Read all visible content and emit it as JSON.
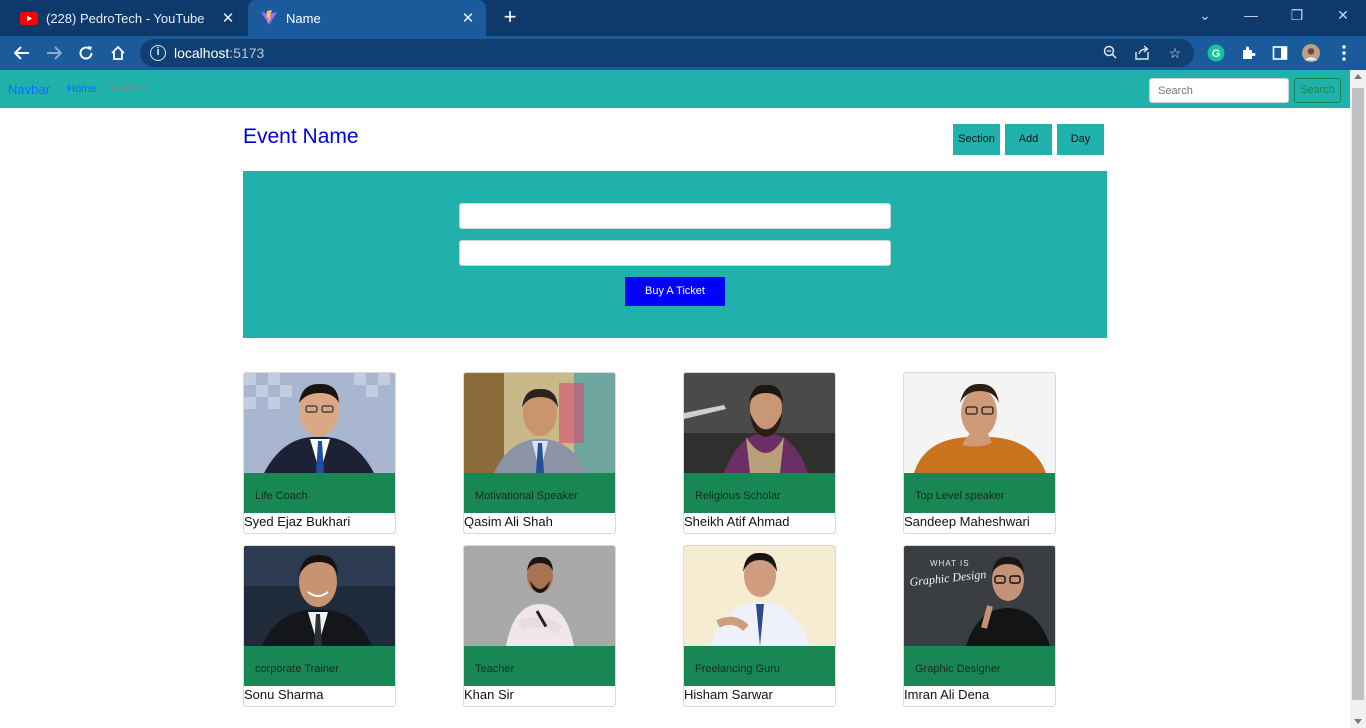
{
  "browser": {
    "tabs": [
      {
        "title": "(228) PedroTech - YouTube",
        "active": false
      },
      {
        "title": "Name",
        "active": true
      }
    ],
    "url_host": "localhost",
    "url_port": ":5173"
  },
  "navbar": {
    "brand": "Navbar",
    "home": "Home",
    "disabled": "Disabled",
    "search_placeholder": "Search",
    "search_button": "Search"
  },
  "event": {
    "title": "Event Name",
    "buttons": [
      "Section",
      "Add",
      "Day"
    ],
    "buy_button": "Buy A Ticket"
  },
  "speakers": [
    {
      "role": "Life Coach",
      "name": "Syed Ejaz Bukhari"
    },
    {
      "role": "Motivational Speaker",
      "name": "Qasim Ali Shah"
    },
    {
      "role": "Religious Scholar",
      "name": "Sheikh Atif Ahmad"
    },
    {
      "role": "Top Level speaker",
      "name": "Sandeep Maheshwari"
    },
    {
      "role": "corporate Trainer",
      "name": "Sonu Sharma"
    },
    {
      "role": "Teacher",
      "name": "Khan Sir"
    },
    {
      "role": "Freelancing Guru",
      "name": "Hisham Sarwar"
    },
    {
      "role": "Graphic Designer",
      "name": "Imran Ali Dena"
    }
  ],
  "speaker_photo_text": {
    "graphic_design_line1": "WHAT IS",
    "graphic_design_line2": "Graphic Design"
  },
  "colors": {
    "teal": "#20b2aa",
    "green": "#198754",
    "blue": "#0000ff",
    "chrome_dark": "#0e3a6b",
    "chrome_mid": "#1b5b9b"
  }
}
